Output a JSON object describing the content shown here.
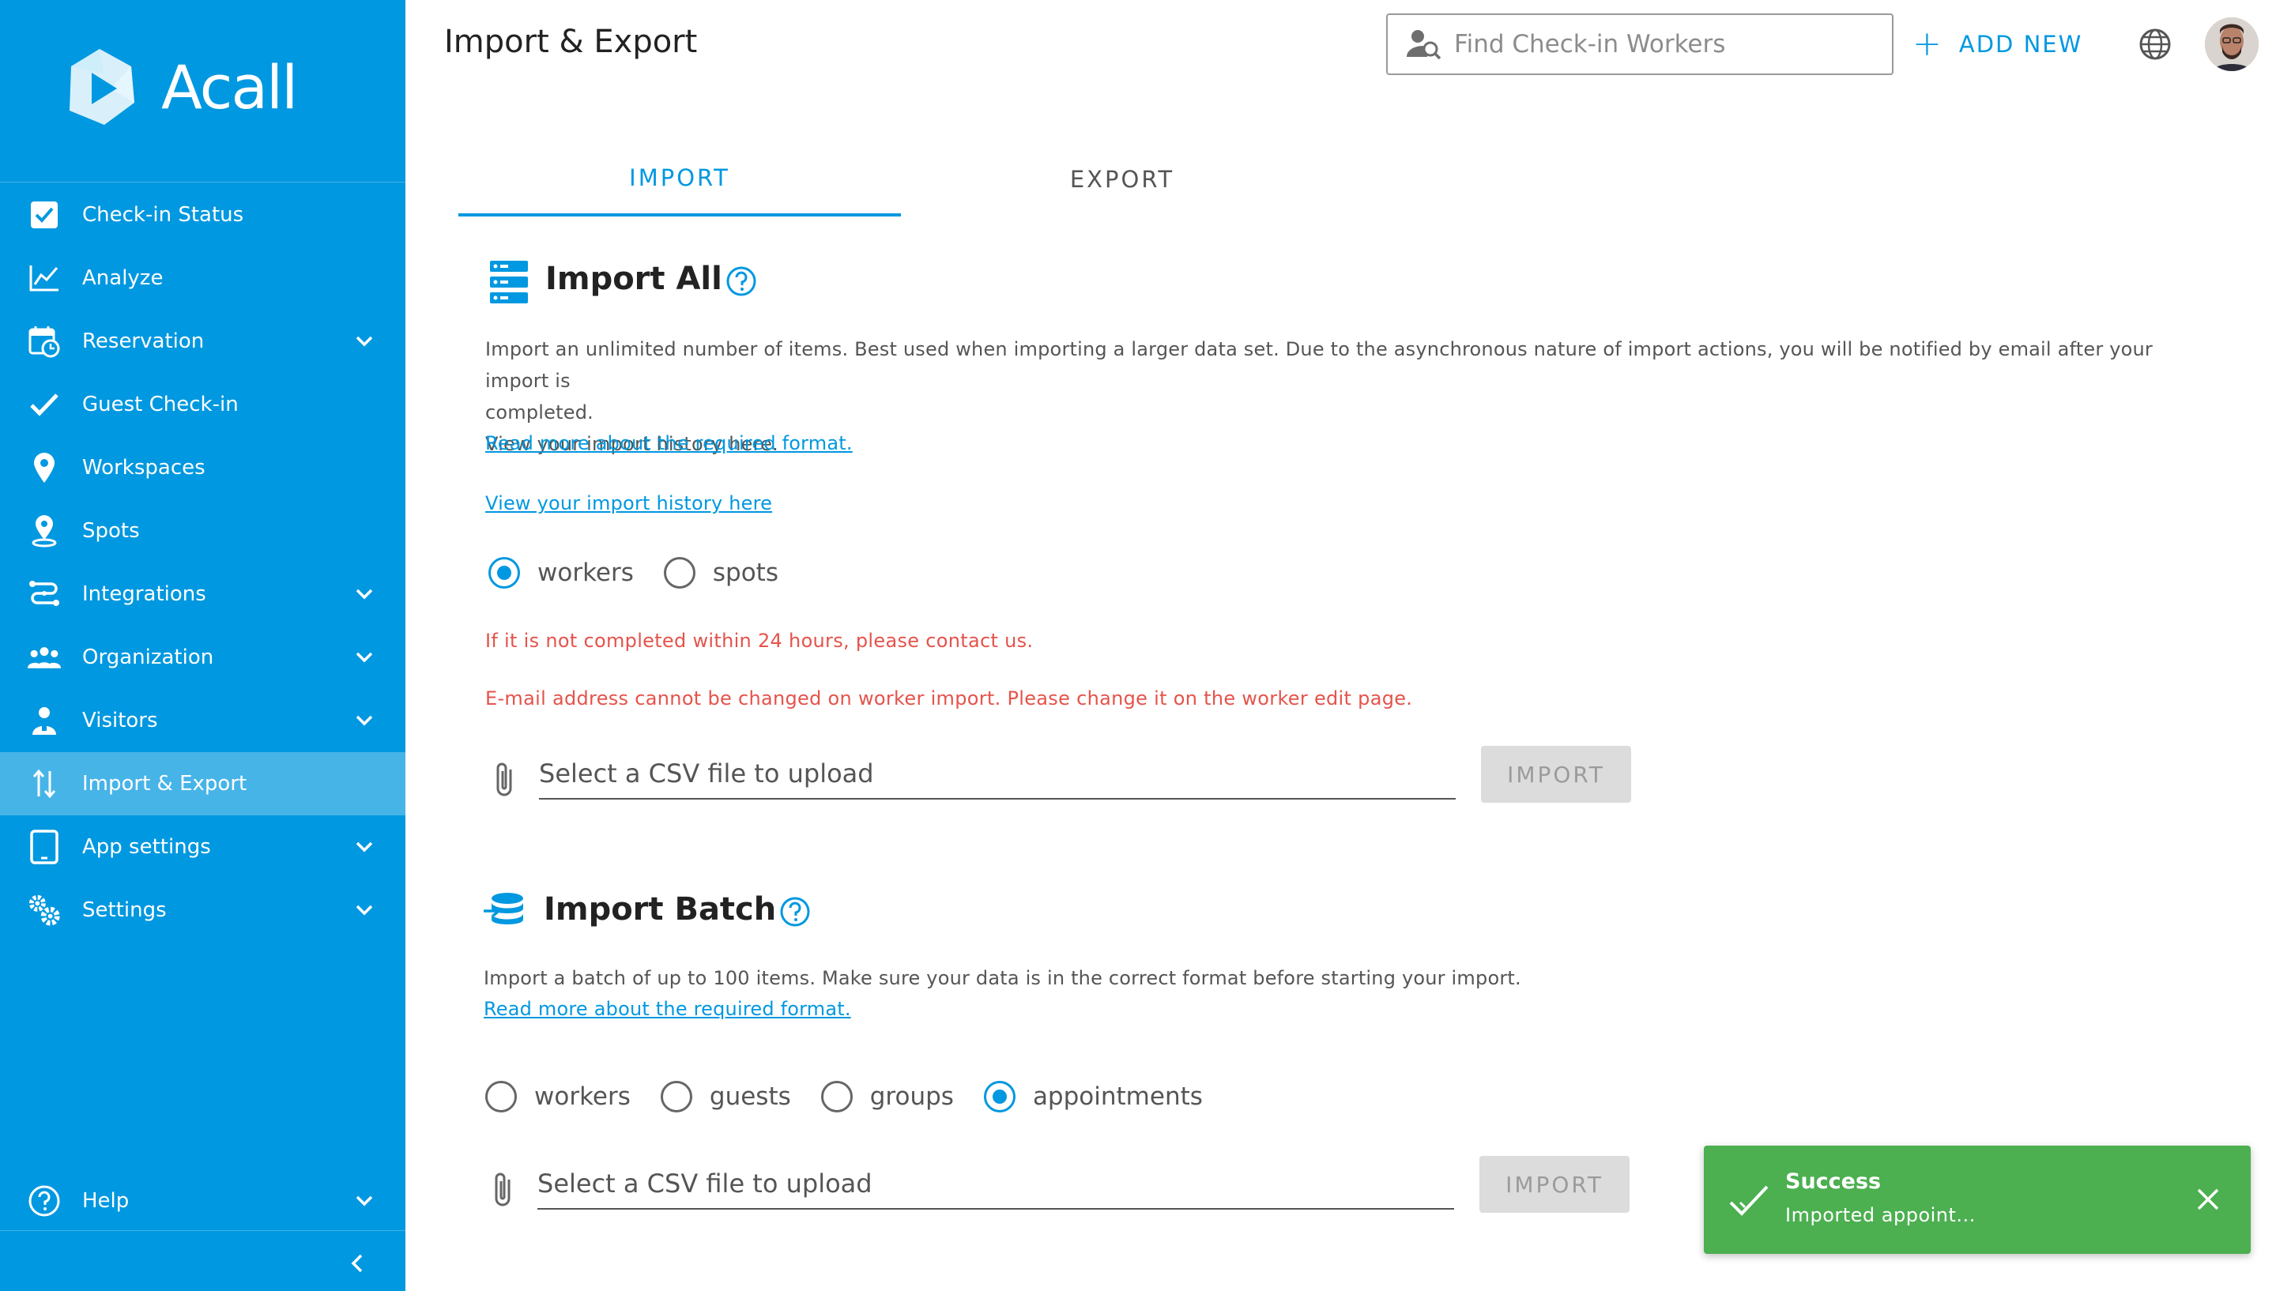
{
  "brand": {
    "name": "Acall"
  },
  "sidebar": {
    "items": [
      {
        "label": "Check-in Status",
        "icon": "checkbox-icon",
        "expandable": false,
        "active": false
      },
      {
        "label": "Analyze",
        "icon": "chart-line-icon",
        "expandable": false,
        "active": false
      },
      {
        "label": "Reservation",
        "icon": "calendar-clock-icon",
        "expandable": true,
        "active": false
      },
      {
        "label": "Guest Check-in",
        "icon": "checkmark-icon",
        "expandable": false,
        "active": false
      },
      {
        "label": "Workspaces",
        "icon": "map-pin-icon",
        "expandable": false,
        "active": false
      },
      {
        "label": "Spots",
        "icon": "location-pin-icon",
        "expandable": false,
        "active": false
      },
      {
        "label": "Integrations",
        "icon": "integrations-icon",
        "expandable": true,
        "active": false
      },
      {
        "label": "Organization",
        "icon": "people-group-icon",
        "expandable": true,
        "active": false
      },
      {
        "label": "Visitors",
        "icon": "visitor-icon",
        "expandable": true,
        "active": false
      },
      {
        "label": "Import & Export",
        "icon": "import-export-icon",
        "expandable": false,
        "active": true
      },
      {
        "label": "App settings",
        "icon": "tablet-icon",
        "expandable": true,
        "active": false
      },
      {
        "label": "Settings",
        "icon": "gears-icon",
        "expandable": true,
        "active": false
      }
    ],
    "help_label": "Help"
  },
  "header": {
    "title": "Import & Export",
    "search_placeholder": "Find Check-in Workers",
    "add_new_label": "ADD NEW"
  },
  "tabs": [
    {
      "label": "IMPORT",
      "active": true
    },
    {
      "label": "EXPORT",
      "active": false
    }
  ],
  "import_all": {
    "title": "Import All",
    "desc_line1": "Import an unlimited number of items. Best used when importing a larger data set. Due to the asynchronous nature of import actions, you will be notified by email after your import is",
    "desc_line2": "completed.",
    "desc_line3": "View your import history here.",
    "format_link": "Read more about the required format.",
    "history_link": "View your import history here",
    "radios": [
      {
        "label": "workers",
        "checked": true
      },
      {
        "label": "spots",
        "checked": false
      }
    ],
    "warning1": "If it is not completed within 24 hours, please contact us.",
    "warning2": "E-mail address cannot be changed on worker import. Please change it on the worker edit page.",
    "file_placeholder": "Select a CSV file to upload",
    "import_button": "IMPORT"
  },
  "import_batch": {
    "title": "Import Batch",
    "desc": "Import a batch of up to 100 items. Make sure your data is in the correct format before starting your import.",
    "format_link": "Read more about the required format.",
    "radios": [
      {
        "label": "workers",
        "checked": false
      },
      {
        "label": "guests",
        "checked": false
      },
      {
        "label": "groups",
        "checked": false
      },
      {
        "label": "appointments",
        "checked": true
      }
    ],
    "file_placeholder": "Select a CSV file to upload",
    "import_button": "IMPORT"
  },
  "toast": {
    "title": "Success",
    "message": "Imported appoint...",
    "color": "#4caf50"
  },
  "colors": {
    "sidebar": "#0098e0",
    "accent": "#0098e0",
    "warning": "#e5534b",
    "disabled_button": "#dcdcdc"
  }
}
